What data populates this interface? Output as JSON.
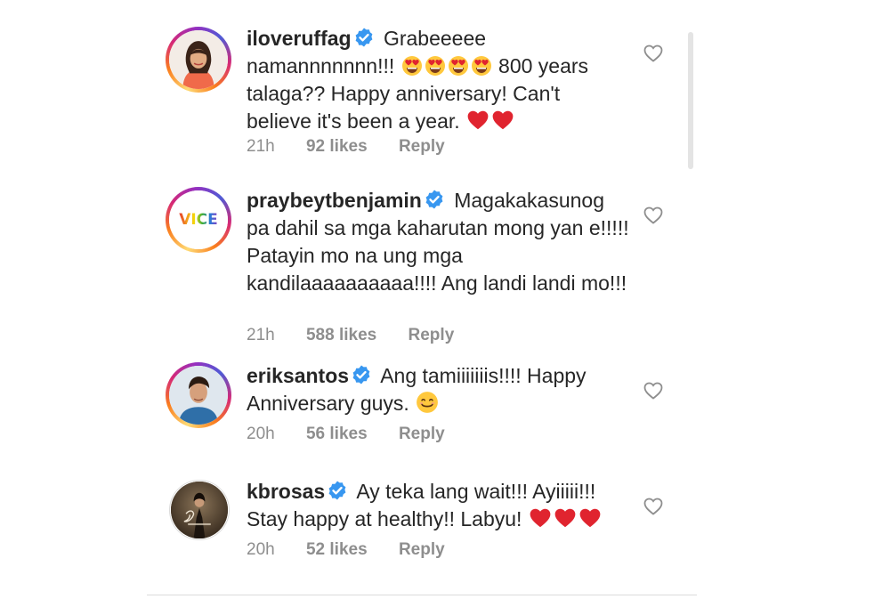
{
  "comments": [
    {
      "username": "iloveruffag",
      "text": "Grabeeeee namannnnnnn!!!",
      "text_after": "800 years talaga?? Happy anniversary! Can't believe it's been a year.",
      "time": "21h",
      "likes": "92 likes",
      "reply": "Reply"
    },
    {
      "username": "praybeytbenjamin",
      "text": "Magakakasunog pa dahil sa mga kaharutan mong yan e!!!!! Patayin mo na ung mga kandilaaaaaaaaaa!!!! Ang landi landi mo!!!",
      "avatar_label": "VICE",
      "time": "21h",
      "likes": "588 likes",
      "reply": "Reply"
    },
    {
      "username": "eriksantos",
      "text": "Ang tamiiiiiiis!!!! Happy Anniversary guys.",
      "time": "20h",
      "likes": "56 likes",
      "reply": "Reply"
    },
    {
      "username": "kbrosas",
      "text": "Ay teka lang wait!!! Ayiiiii!!! Stay happy at healthy!! Labyu!",
      "time": "20h",
      "likes": "52 likes",
      "reply": "Reply"
    }
  ],
  "colors": {
    "verified": "#3897f0",
    "heart_red": "#e0242f",
    "meta": "#8e8e8e",
    "text": "#262626"
  },
  "icons": {
    "verified": "verified-badge-icon",
    "like": "heart-outline-icon",
    "heart_emoji": "red-heart-emoji",
    "heart_eyes": "heart-eyes-emoji",
    "smile": "smiling-face-emoji"
  }
}
